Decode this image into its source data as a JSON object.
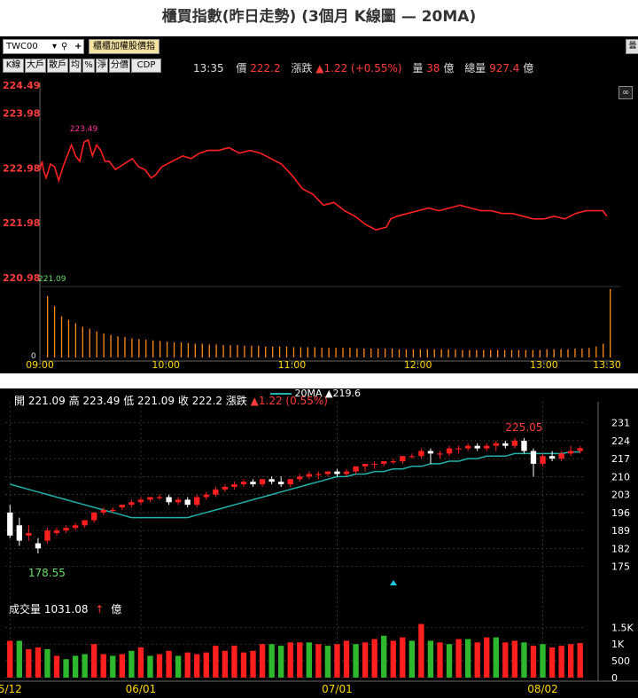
{
  "title": "櫃買指數(昨日走勢) (3個月 K線圖 — 20MA)",
  "intraday": {
    "code": "TWC00",
    "dropdown_caret": "▾",
    "index_button": "櫃櫃加權股價指",
    "tabs": [
      "K線",
      "大戶",
      "散戶",
      "均",
      "%",
      "淨",
      "分價",
      "CDP"
    ],
    "time": "13:35",
    "price_label": "價",
    "price": "222.2",
    "change_label": "漲跌",
    "change": "▲1.22 (+0.55%)",
    "volume_label": "量",
    "volume": "38",
    "volume_unit": "億",
    "total_label": "總量",
    "total": "927.4",
    "total_unit": "億",
    "corner_char": "曇",
    "high_label": "223.49",
    "low_label": "221.09",
    "colors": {
      "line": "#ff2020",
      "axis_text": "#ff3b3b",
      "volume": "#ff8c1a",
      "time": "#ffd700"
    },
    "chart_data": {
      "type": "line",
      "ylim": [
        220.98,
        224.49
      ],
      "yticks": [
        "224.49",
        "223.98",
        "222.98",
        "221.98",
        "220.98"
      ],
      "xticks": [
        "09:00",
        "10:00",
        "11:00",
        "12:00",
        "13:00",
        "13:30"
      ],
      "volume_zero_label": "0",
      "price": [
        [
          "09:00",
          222.95
        ],
        [
          "09:01",
          223.1
        ],
        [
          "09:02",
          222.9
        ],
        [
          "09:03",
          222.8
        ],
        [
          "09:05",
          223.05
        ],
        [
          "09:07",
          223.0
        ],
        [
          "09:09",
          222.75
        ],
        [
          "09:11",
          223.0
        ],
        [
          "09:13",
          223.2
        ],
        [
          "09:15",
          223.4
        ],
        [
          "09:17",
          223.2
        ],
        [
          "09:19",
          223.1
        ],
        [
          "09:21",
          223.45
        ],
        [
          "09:23",
          223.49
        ],
        [
          "09:25",
          223.2
        ],
        [
          "09:27",
          223.4
        ],
        [
          "09:29",
          223.3
        ],
        [
          "09:31",
          223.1
        ],
        [
          "09:33",
          223.1
        ],
        [
          "09:36",
          222.95
        ],
        [
          "09:40",
          223.05
        ],
        [
          "09:44",
          223.15
        ],
        [
          "09:47",
          223.0
        ],
        [
          "09:50",
          222.95
        ],
        [
          "09:53",
          222.8
        ],
        [
          "09:55",
          222.85
        ],
        [
          "09:58",
          223.0
        ],
        [
          "10:03",
          223.1
        ],
        [
          "10:08",
          223.2
        ],
        [
          "10:12",
          223.15
        ],
        [
          "10:16",
          223.25
        ],
        [
          "10:20",
          223.3
        ],
        [
          "10:25",
          223.3
        ],
        [
          "10:30",
          223.35
        ],
        [
          "10:35",
          223.25
        ],
        [
          "10:40",
          223.3
        ],
        [
          "10:45",
          223.25
        ],
        [
          "10:50",
          223.15
        ],
        [
          "10:55",
          223.05
        ],
        [
          "11:00",
          222.85
        ],
        [
          "11:05",
          222.6
        ],
        [
          "11:10",
          222.5
        ],
        [
          "11:15",
          222.3
        ],
        [
          "11:20",
          222.35
        ],
        [
          "11:25",
          222.2
        ],
        [
          "11:30",
          222.1
        ],
        [
          "11:35",
          221.95
        ],
        [
          "11:40",
          221.85
        ],
        [
          "11:45",
          221.9
        ],
        [
          "11:47",
          222.05
        ],
        [
          "11:50",
          222.1
        ],
        [
          "11:55",
          222.15
        ],
        [
          "12:00",
          222.2
        ],
        [
          "12:05",
          222.25
        ],
        [
          "12:10",
          222.2
        ],
        [
          "12:15",
          222.25
        ],
        [
          "12:20",
          222.3
        ],
        [
          "12:25",
          222.25
        ],
        [
          "12:30",
          222.2
        ],
        [
          "12:35",
          222.2
        ],
        [
          "12:40",
          222.15
        ],
        [
          "12:45",
          222.15
        ],
        [
          "12:50",
          222.1
        ],
        [
          "12:55",
          222.05
        ],
        [
          "13:00",
          222.05
        ],
        [
          "13:05",
          222.1
        ],
        [
          "13:10",
          222.05
        ],
        [
          "13:15",
          222.15
        ],
        [
          "13:20",
          222.2
        ],
        [
          "13:25",
          222.2
        ],
        [
          "13:28",
          222.2
        ],
        [
          "13:30",
          222.1
        ]
      ],
      "volume_note": "opening and closing auction bars are tall; intraday bars are small",
      "volume": [
        0.9,
        0.75,
        0.6,
        0.55,
        0.5,
        0.45,
        0.42,
        0.38,
        0.35,
        0.33,
        0.31,
        0.3,
        0.28,
        0.27,
        0.26,
        0.25,
        0.24,
        0.23,
        0.22,
        0.22,
        0.21,
        0.2,
        0.2,
        0.19,
        0.19,
        0.18,
        0.18,
        0.18,
        0.17,
        0.17,
        0.17,
        0.16,
        0.16,
        0.16,
        0.16,
        0.15,
        0.15,
        0.15,
        0.15,
        0.14,
        0.14,
        0.14,
        0.14,
        0.14,
        0.13,
        0.13,
        0.13,
        0.13,
        0.13,
        0.13,
        0.12,
        0.12,
        0.12,
        0.12,
        0.12,
        0.12,
        0.12,
        0.12,
        0.12,
        0.11,
        0.11,
        0.11,
        0.11,
        0.11,
        0.11,
        0.11,
        0.11,
        0.11,
        0.11,
        0.11,
        0.11,
        0.12,
        0.12,
        0.12,
        0.12,
        0.13,
        0.13,
        0.14,
        0.16,
        0.2,
        1.0
      ]
    }
  },
  "kline": {
    "ohlc_header": "開 221.09 高 223.49 低 221.09 收 222.2 漲跌",
    "ohlc_change": "▲1.22 (0.55%)",
    "ma_label": "20MA",
    "ma_value": "▲219.6",
    "high_annotation": "225.05",
    "low_annotation": "178.55",
    "volume_label": "成交量",
    "volume_value": "1031.08",
    "volume_arrow": "↑",
    "volume_unit": "億",
    "colors": {
      "up": "#ff1f1f",
      "down": "#ffffff",
      "ma": "#20b2aa",
      "vol_up": "#ff1f1f",
      "vol_down": "#2db82d",
      "grid": "#444444"
    },
    "chart_data": {
      "type": "candlestick",
      "ylim": [
        170,
        234
      ],
      "yticks": [
        231,
        224,
        217,
        210,
        203,
        196,
        189,
        182,
        175
      ],
      "volume_yticks": [
        "1.5K",
        "1K",
        "500",
        "0"
      ],
      "volume_ylim": [
        0,
        1800
      ],
      "xticks": [
        {
          "label": "5/12",
          "index": 0
        },
        {
          "label": "06/01",
          "index": 14
        },
        {
          "label": "07/01",
          "index": 35
        },
        {
          "label": "08/02",
          "index": 57
        }
      ],
      "candles": [
        [
          196,
          199,
          186,
          187
        ],
        [
          191,
          194,
          183,
          185
        ],
        [
          187,
          191,
          185,
          188
        ],
        [
          184,
          186,
          180,
          182
        ],
        [
          185,
          190,
          184,
          189
        ],
        [
          188,
          190,
          187,
          189
        ],
        [
          189,
          191,
          188,
          190
        ],
        [
          190,
          192,
          189,
          191
        ],
        [
          191,
          193,
          190,
          193
        ],
        [
          193,
          196,
          192,
          196
        ],
        [
          196,
          198,
          195,
          197
        ],
        [
          197,
          198,
          196,
          197
        ],
        [
          198,
          199,
          197,
          199
        ],
        [
          199,
          201,
          198,
          200
        ],
        [
          200,
          202,
          199,
          201
        ],
        [
          201,
          202,
          200,
          202
        ],
        [
          202,
          203,
          201,
          202
        ],
        [
          202,
          203,
          199,
          200
        ],
        [
          200,
          202,
          199,
          201
        ],
        [
          201,
          202,
          198,
          199
        ],
        [
          199,
          203,
          198,
          202
        ],
        [
          202,
          204,
          201,
          203
        ],
        [
          203,
          206,
          202,
          205
        ],
        [
          205,
          207,
          204,
          206
        ],
        [
          206,
          208,
          205,
          207
        ],
        [
          207,
          209,
          206,
          208
        ],
        [
          208,
          209,
          206,
          207
        ],
        [
          207,
          209,
          206,
          209
        ],
        [
          209,
          210,
          207,
          208
        ],
        [
          208,
          210,
          206,
          207
        ],
        [
          207,
          209,
          206,
          209
        ],
        [
          209,
          211,
          208,
          210
        ],
        [
          210,
          212,
          209,
          211
        ],
        [
          211,
          212,
          209,
          211
        ],
        [
          211,
          212,
          210,
          212
        ],
        [
          212,
          213,
          210,
          211
        ],
        [
          211,
          213,
          210,
          212
        ],
        [
          212,
          214,
          211,
          214
        ],
        [
          214,
          215,
          212,
          215
        ],
        [
          215,
          216,
          213,
          215
        ],
        [
          215,
          216,
          214,
          216
        ],
        [
          216,
          217,
          215,
          216
        ],
        [
          216,
          218,
          215,
          218
        ],
        [
          218,
          219,
          217,
          218
        ],
        [
          218,
          221,
          217,
          220
        ],
        [
          220,
          221,
          215,
          219
        ],
        [
          219,
          220,
          217,
          219
        ],
        [
          219,
          222,
          218,
          221
        ],
        [
          221,
          222,
          219,
          221
        ],
        [
          221,
          223,
          220,
          222
        ],
        [
          222,
          223,
          220,
          221
        ],
        [
          221,
          223,
          220,
          222
        ],
        [
          222,
          224,
          220,
          223
        ],
        [
          223,
          224,
          221,
          222
        ],
        [
          222,
          225,
          221,
          224
        ],
        [
          224,
          225.05,
          219,
          220
        ],
        [
          220,
          221,
          210,
          215
        ],
        [
          215,
          219,
          214,
          218
        ],
        [
          218,
          220,
          216,
          217
        ],
        [
          217,
          220,
          216,
          219
        ],
        [
          219,
          222,
          218,
          220
        ],
        [
          220,
          222,
          219,
          221.09
        ]
      ],
      "ma20": [
        207,
        206,
        205,
        204,
        203,
        202,
        201,
        200,
        199,
        198,
        197,
        196,
        195,
        194,
        194,
        194,
        194,
        194,
        194,
        194,
        195,
        196,
        197,
        198,
        199,
        200,
        201,
        202,
        203,
        204,
        205,
        206,
        207,
        208,
        209,
        210,
        210,
        211,
        211,
        212,
        212,
        213,
        213,
        214,
        214,
        215,
        215,
        216,
        216,
        217,
        217,
        218,
        218,
        218,
        219,
        219,
        219,
        219,
        219,
        219,
        219.6,
        219.6
      ],
      "volume": [
        [
          1100,
          1
        ],
        [
          1100,
          0
        ],
        [
          850,
          1
        ],
        [
          900,
          1
        ],
        [
          850,
          0
        ],
        [
          650,
          1
        ],
        [
          550,
          0
        ],
        [
          650,
          0
        ],
        [
          700,
          0
        ],
        [
          1000,
          1
        ],
        [
          700,
          1
        ],
        [
          650,
          0
        ],
        [
          700,
          1
        ],
        [
          800,
          0
        ],
        [
          900,
          1
        ],
        [
          650,
          0
        ],
        [
          700,
          1
        ],
        [
          800,
          1
        ],
        [
          650,
          0
        ],
        [
          750,
          1
        ],
        [
          700,
          1
        ],
        [
          750,
          1
        ],
        [
          950,
          1
        ],
        [
          800,
          1
        ],
        [
          950,
          1
        ],
        [
          750,
          1
        ],
        [
          800,
          1
        ],
        [
          1000,
          1
        ],
        [
          1000,
          0
        ],
        [
          950,
          0
        ],
        [
          1050,
          1
        ],
        [
          1050,
          1
        ],
        [
          1050,
          0
        ],
        [
          1000,
          1
        ],
        [
          950,
          0
        ],
        [
          1000,
          1
        ],
        [
          1100,
          1
        ],
        [
          1000,
          0
        ],
        [
          1050,
          1
        ],
        [
          1150,
          1
        ],
        [
          1250,
          0
        ],
        [
          1100,
          1
        ],
        [
          1200,
          1
        ],
        [
          1100,
          0
        ],
        [
          1600,
          1
        ],
        [
          1100,
          0
        ],
        [
          1050,
          1
        ],
        [
          1000,
          0
        ],
        [
          1150,
          1
        ],
        [
          1150,
          0
        ],
        [
          1050,
          1
        ],
        [
          1200,
          1
        ],
        [
          1200,
          0
        ],
        [
          1050,
          1
        ],
        [
          1100,
          1
        ],
        [
          1050,
          0
        ],
        [
          950,
          1
        ],
        [
          1000,
          0
        ],
        [
          900,
          1
        ],
        [
          950,
          1
        ],
        [
          1000,
          1
        ],
        [
          1030,
          1
        ]
      ]
    }
  }
}
